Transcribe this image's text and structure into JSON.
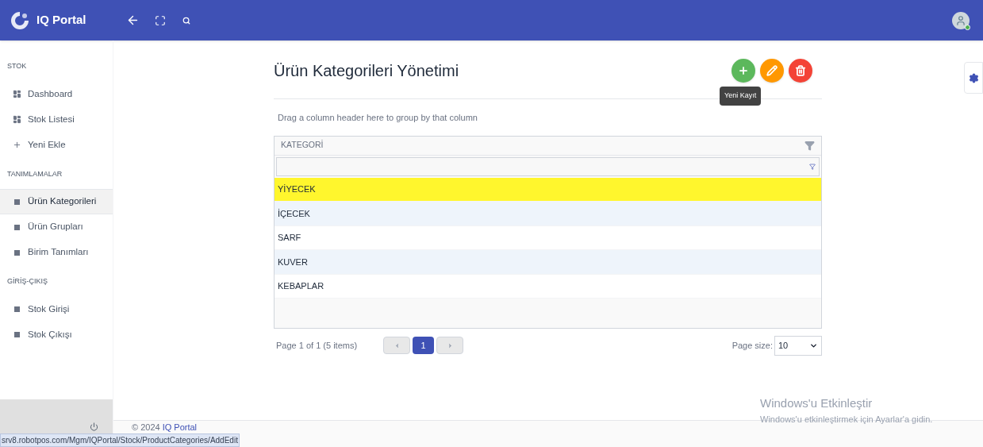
{
  "header": {
    "brand": "IQ Portal"
  },
  "sidebar": {
    "sections": [
      {
        "title": "STOK",
        "items": [
          {
            "label": "Dashboard",
            "kind": "grid",
            "selected": false
          },
          {
            "label": "Stok Listesi",
            "kind": "grid",
            "selected": false
          },
          {
            "label": "Yeni Ekle",
            "kind": "plus",
            "selected": false
          }
        ]
      },
      {
        "title": "TANIMLAMALAR",
        "items": [
          {
            "label": "Ürün Kategorileri",
            "kind": "square",
            "selected": true
          },
          {
            "label": "Ürün Grupları",
            "kind": "square",
            "selected": false
          },
          {
            "label": "Birim Tanımları",
            "kind": "square",
            "selected": false
          }
        ]
      },
      {
        "title": "GİRİŞ-ÇIKIŞ",
        "items": [
          {
            "label": "Stok Girişi",
            "kind": "square",
            "selected": false
          },
          {
            "label": "Stok Çıkışı",
            "kind": "square",
            "selected": false
          }
        ]
      }
    ]
  },
  "page": {
    "title": "Ürün Kategorileri Yönetimi",
    "actions": [
      {
        "kind": "add"
      },
      {
        "kind": "edit"
      },
      {
        "kind": "delete"
      }
    ],
    "tooltip": "Yeni Kayıt"
  },
  "grid": {
    "group_panel": "Drag a column header here to group by that column",
    "columns": [
      "KATEGORİ"
    ],
    "rows": [
      {
        "cells": [
          "YİYECEK"
        ],
        "selected": true
      },
      {
        "cells": [
          "İÇECEK"
        ],
        "selected": false
      },
      {
        "cells": [
          "SARF"
        ],
        "selected": false
      },
      {
        "cells": [
          "KUVER"
        ],
        "selected": false
      },
      {
        "cells": [
          "KEBAPLAR"
        ],
        "selected": false
      }
    ],
    "pager": {
      "summary": "Page 1 of 1 (5 items)",
      "pages": [
        {
          "label": "1",
          "selected": true
        }
      ],
      "page_size_label": "Page size:",
      "page_size": "10"
    }
  },
  "footer": {
    "copyright": "© 2024",
    "link": "IQ Portal"
  },
  "status_url": "srv8.robotpos.com/Mgm/IQPortal/Stock/ProductCategories/AddEdit",
  "os_notice": {
    "title": "Windows'u Etkinleştir",
    "text": "Windows'u etkinleştirmek için Ayarlar'a gidin."
  }
}
